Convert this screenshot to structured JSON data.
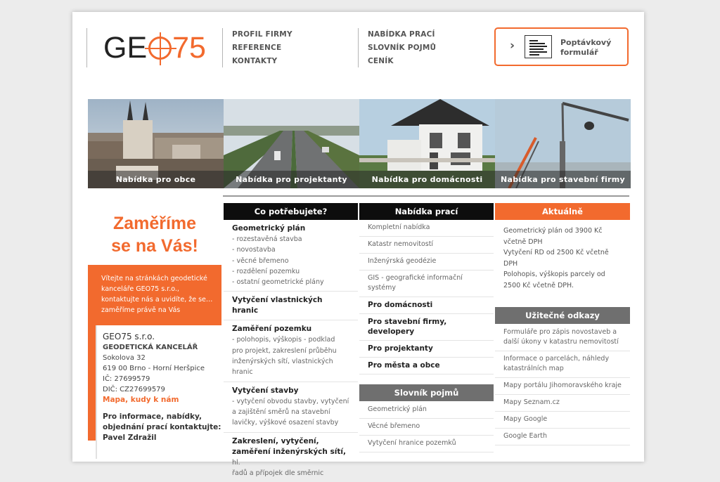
{
  "logo": {
    "prefix": "GE",
    "number": "75"
  },
  "nav": {
    "col1": [
      "PROFIL FIRMY",
      "REFERENCE",
      "KONTAKTY"
    ],
    "col2": [
      "NABÍDKA PRACÍ",
      "SLOVNÍK POJMŮ",
      "CENÍK"
    ]
  },
  "form_button": {
    "label": "Poptávkový formulář",
    "icon": "chevron-right-icon",
    "doc_icon": "form-document-icon"
  },
  "photos": [
    {
      "caption": "Nabídka pro obce"
    },
    {
      "caption": "Nabídka pro projektanty"
    },
    {
      "caption": "Nabídka pro domácnosti"
    },
    {
      "caption": "Nabídka pro stavební firmy"
    }
  ],
  "left": {
    "slogan_line1": "Zaměříme",
    "slogan_line2": "se na Vás!",
    "welcome": "Vítejte na stránkách geodetické kanceláře GEO75 s.r.o., kontaktujte nás a uvidíte, že se…zaměříme právě na Vás",
    "company": "GEO75 s.r.o.",
    "subtitle": "GEODETICKÁ KANCELÁŘ",
    "street": "Sokolova 32",
    "city": "619 00 Brno - Horní Heršpice",
    "ic": "IČ: 27699579",
    "dic": "DIČ: CZ27699579",
    "map_link": "Mapa, kudy k nám",
    "info_line1": "Pro informace, nabídky,",
    "info_line2": "objednání prací kontaktujte:",
    "person": "Pavel Zdražil"
  },
  "col_potrebujete": {
    "heading": "Co potřebujete?",
    "blocks": [
      {
        "title": "Geometrický plán",
        "items": [
          "- rozestavěná stavba",
          "- novostavba",
          "- věcné břemeno",
          "- rozdělení pozemku",
          "- ostatní geometrické plány"
        ]
      },
      {
        "title": "Vytyčení vlastnických hranic",
        "items": []
      },
      {
        "title": "Zaměření pozemku",
        "items": [
          "- polohopis, výškopis - podklad",
          "pro projekt, zakreslení průběhu",
          "inženýrských sítí, vlastnických",
          "hranic"
        ]
      },
      {
        "title": "Vytyčení stavby",
        "items": [
          "- vytyčení obvodu stavby, vytyčení",
          "a zajištění směrů na stavební",
          "lavičky, výškové osazení stavby"
        ]
      }
    ],
    "last_title1": "Zakreslení, vytyčení,",
    "last_title2": "zaměření inženýrských sítí,",
    "last_tail": " hl.",
    "last_sub": "řadů a přípojek dle směrnic"
  },
  "col_nabidka": {
    "heading": "Nabídka prací",
    "items": [
      "Kompletní nabídka",
      "Katastr nemovitostí",
      "Inženýrská geodézie",
      "GIS - geografické informační systémy"
    ],
    "bold_items": [
      "Pro domácnosti",
      "Pro stavební firmy, developery",
      "Pro projektanty",
      "Pro města a obce"
    ],
    "slovnik_heading": "Slovník pojmů",
    "slovnik_items": [
      "Geometrický plán",
      "Věcné břemeno",
      "Vytyčení hranice pozemků"
    ]
  },
  "col_aktualne": {
    "heading": "Aktuálně",
    "text": [
      "Geometrický plán od 3900 Kč",
      "včetně DPH",
      "Vytyčení RD od 2500 Kč včetně",
      "DPH",
      "Polohopis, výškopis parcely od",
      "2500 Kč včetně DPH."
    ],
    "odkazy_heading": "Užitečné odkazy",
    "odkazy": [
      "Formuláře pro zápis novostaveb a další úkony v katastru nemovitostí",
      "Informace o parcelách, náhledy katastrálních map",
      "Mapy portálu Jihomoravského kraje",
      "Mapy Seznam.cz",
      "Mapy Google",
      "Google Earth"
    ]
  },
  "colors": {
    "accent": "#f26a2e",
    "dark_header": "#0d0d0d",
    "gray_header": "#6f6f6f"
  }
}
